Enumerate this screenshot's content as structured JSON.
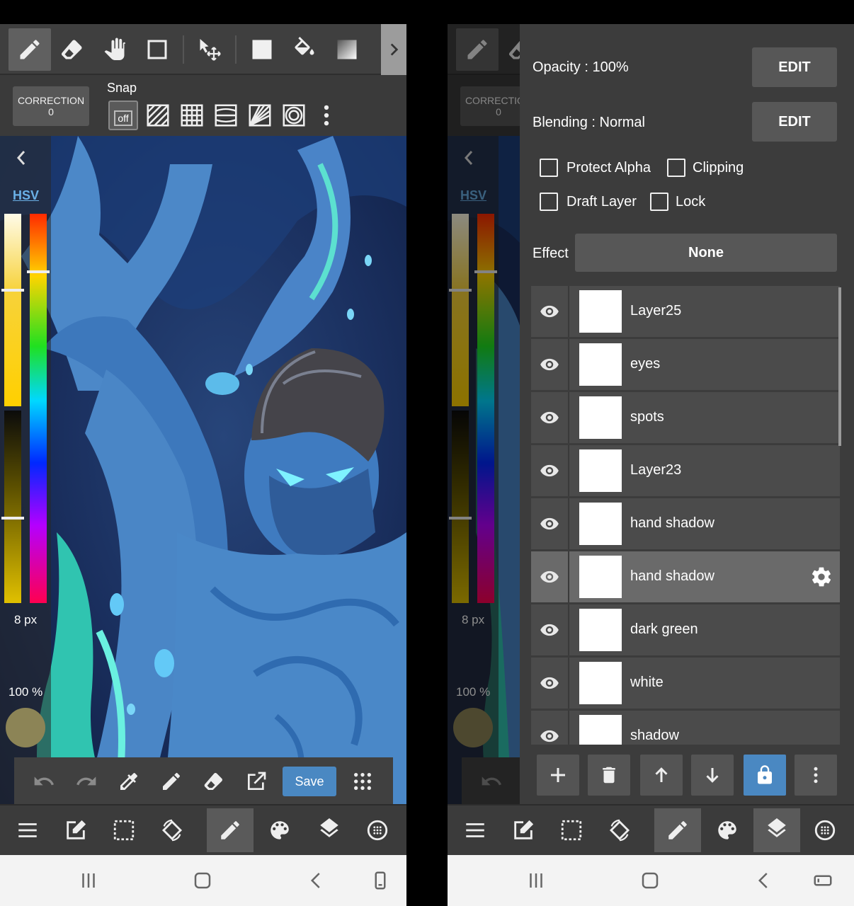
{
  "left": {
    "correction": {
      "label": "CORRECTION",
      "value": "0"
    },
    "snap_label": "Snap",
    "snap_off_label": "off",
    "color_model": "HSV",
    "brush_size": "8 px",
    "brush_opacity": "100 %",
    "current_color": "#8c8456",
    "save_label": "Save",
    "accent_color": "#4a88c2"
  },
  "right": {
    "correction": {
      "label": "CORRECTION",
      "value": "0"
    },
    "color_model": "HSV",
    "brush_size": "8 px",
    "brush_opacity": "100 %",
    "opacity_label": "Opacity : 100%",
    "blending_label": "Blending : Normal",
    "edit_label": "EDIT",
    "checks": {
      "protect_alpha": "Protect Alpha",
      "clipping": "Clipping",
      "draft_layer": "Draft Layer",
      "lock": "Lock"
    },
    "effect_label": "Effect",
    "effect_value": "None",
    "layers": [
      {
        "name": "Layer25",
        "visible": true,
        "selected": false
      },
      {
        "name": "eyes",
        "visible": true,
        "selected": false
      },
      {
        "name": "spots",
        "visible": true,
        "selected": false
      },
      {
        "name": "Layer23",
        "visible": true,
        "selected": false
      },
      {
        "name": "hand shadow",
        "visible": true,
        "selected": false
      },
      {
        "name": "hand shadow",
        "visible": true,
        "selected": true
      },
      {
        "name": "dark green",
        "visible": true,
        "selected": false
      },
      {
        "name": "white",
        "visible": true,
        "selected": false
      },
      {
        "name": "shadow",
        "visible": true,
        "selected": false
      }
    ]
  }
}
